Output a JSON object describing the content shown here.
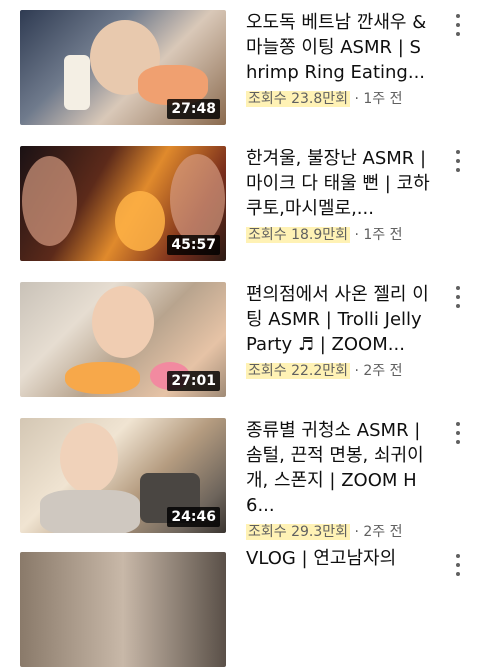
{
  "videos": [
    {
      "title": "오도독 베트남 깐새우 & 마늘쫑 이팅 ASMR | Shrimp Ring Eating...",
      "views": "조회수 23.8만회",
      "sep": " · ",
      "age": "1주 전",
      "duration": "27:48"
    },
    {
      "title": "한겨울, 불장난 ASMR | 마이크 다 태울 뻔 | 코하쿠토,마시멜로,...",
      "views": "조회수 18.9만회",
      "sep": " · ",
      "age": "1주 전",
      "duration": "45:57"
    },
    {
      "title": "편의점에서 사온 젤리 이팅 ASMR | Trolli Jelly Party ♬ | ZOOM...",
      "views": "조회수 22.2만회",
      "sep": " · ",
      "age": "2주 전",
      "duration": "27:01"
    },
    {
      "title": "종류별 귀청소 ASMR | 솜털, 끈적 면봉, 쇠귀이개, 스폰지 | ZOOM H6...",
      "views": "조회수 29.3만회",
      "sep": " · ",
      "age": "2주 전",
      "duration": "24:46"
    },
    {
      "title": "VLOG | 연고남자의",
      "views": "",
      "sep": "",
      "age": "",
      "duration": ""
    }
  ],
  "colors": {
    "highlight": "#ffe878",
    "duration_bg": "#000000",
    "meta_text": "#606060"
  },
  "icons": {
    "more": "more-vert-icon"
  }
}
